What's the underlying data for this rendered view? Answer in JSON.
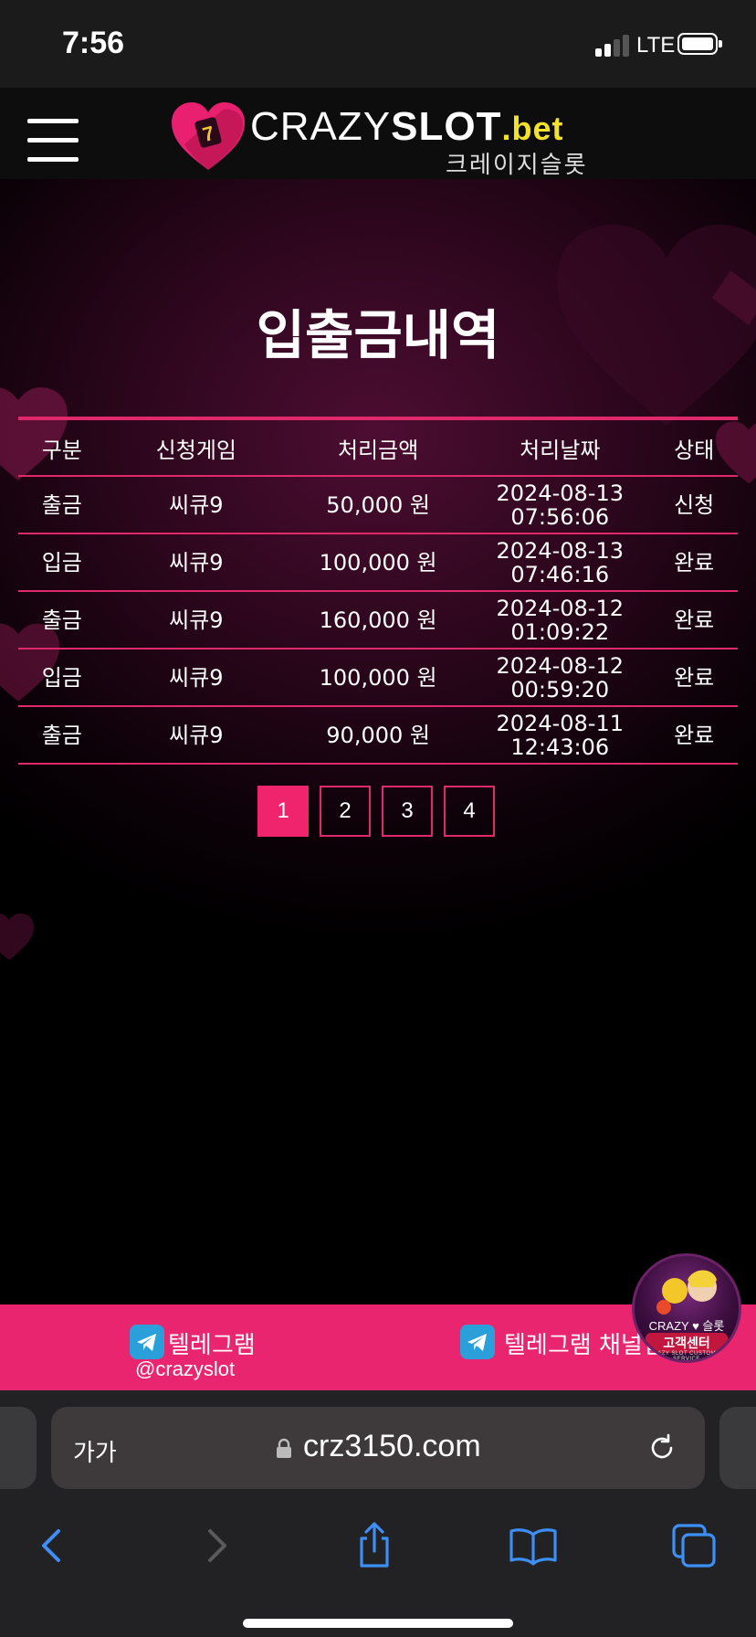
{
  "status_bar": {
    "time": "7:56",
    "network": "LTE",
    "icons": [
      "signal-bars-icon",
      "battery-icon"
    ]
  },
  "header": {
    "menu_icon": "hamburger-menu-icon",
    "logo": {
      "crazy": "CRAZY",
      "slot": "SLOT",
      "bet": ".bet",
      "korean": "크레이지슬롯",
      "icon": "heart-slot-logo-icon"
    }
  },
  "page": {
    "title": "입출금내역"
  },
  "table": {
    "columns": [
      "구분",
      "신청게임",
      "처리금액",
      "처리날짜",
      "상태"
    ],
    "rows": [
      {
        "type": "출금",
        "game": "씨큐9",
        "amount": "50,000 원",
        "date": "2024-08-13",
        "time": "07:56:06",
        "status": "신청"
      },
      {
        "type": "입금",
        "game": "씨큐9",
        "amount": "100,000 원",
        "date": "2024-08-13",
        "time": "07:46:16",
        "status": "완료"
      },
      {
        "type": "출금",
        "game": "씨큐9",
        "amount": "160,000 원",
        "date": "2024-08-12",
        "time": "01:09:22",
        "status": "완료"
      },
      {
        "type": "입금",
        "game": "씨큐9",
        "amount": "100,000 원",
        "date": "2024-08-12",
        "time": "00:59:20",
        "status": "완료"
      },
      {
        "type": "출금",
        "game": "씨큐9",
        "amount": "90,000 원",
        "date": "2024-08-11",
        "time": "12:43:06",
        "status": "완료"
      }
    ]
  },
  "pagination": {
    "pages": [
      "1",
      "2",
      "3",
      "4"
    ],
    "current": "1"
  },
  "footer": {
    "telegram": {
      "label": "텔레그램",
      "handle": "@crazyslot",
      "icon": "telegram-icon"
    },
    "telegram_channel": {
      "label": "텔레그램 채널입",
      "icon": "telegram-icon"
    },
    "support_badge": {
      "brand": "CRAZY ♥ 슬롯",
      "label": "고객센터",
      "sub": "CRAZY SLOT CUSTOMER SERVICE"
    }
  },
  "browser": {
    "aa_label": "가가",
    "url": "crz3150.com",
    "icons": [
      "lock-icon",
      "reload-icon",
      "back-icon",
      "forward-icon",
      "share-icon",
      "bookmarks-icon",
      "tabs-icon"
    ]
  },
  "colors": {
    "accent": "#ea2570",
    "table_line": "#e0296b",
    "logo_bet": "#f3e22a",
    "link_blue": "#3d8ef7"
  }
}
